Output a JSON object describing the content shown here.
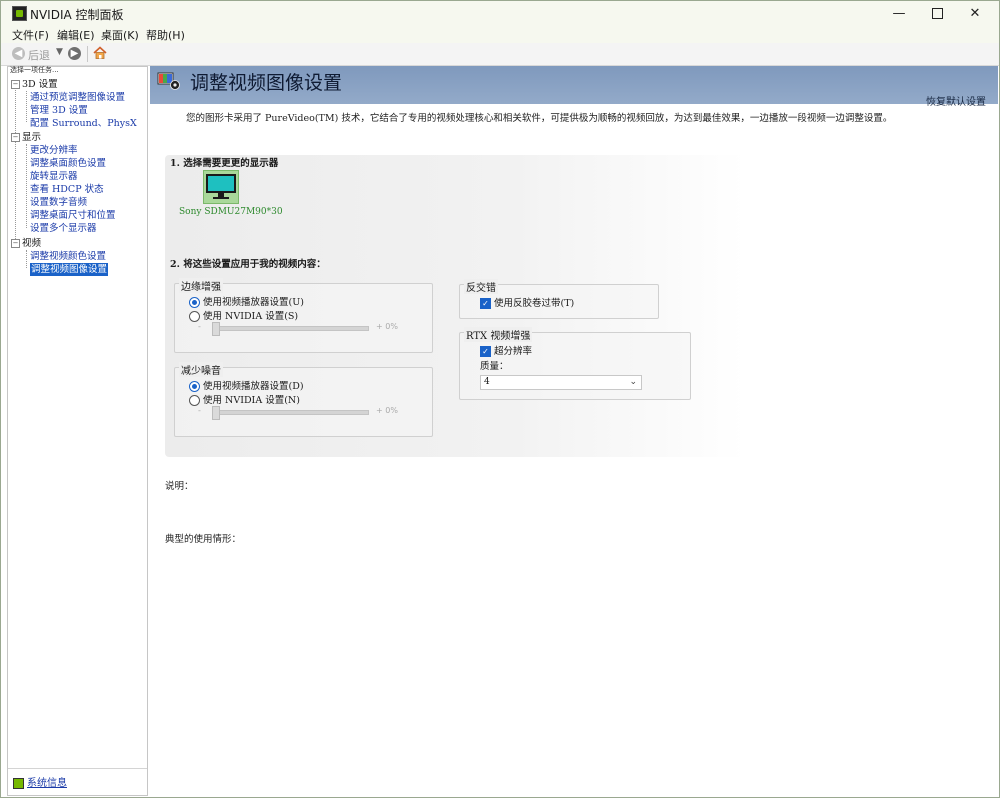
{
  "window": {
    "title": "NVIDIA 控制面板"
  },
  "menu": [
    "文件(F)",
    "编辑(E)",
    "桌面(K)",
    "帮助(H)"
  ],
  "toolbar": {
    "back_label": "后退"
  },
  "left_pane": {
    "task_label": "选择一项任务...",
    "tree": [
      {
        "label": "3D 设置",
        "kind": "parent"
      },
      {
        "label": "通过预览调整图像设置",
        "kind": "child"
      },
      {
        "label": "管理 3D 设置",
        "kind": "child"
      },
      {
        "label": "配置 Surround、PhysX",
        "kind": "child"
      },
      {
        "label": "显示",
        "kind": "parent"
      },
      {
        "label": "更改分辨率",
        "kind": "child"
      },
      {
        "label": "调整桌面颜色设置",
        "kind": "child"
      },
      {
        "label": "旋转显示器",
        "kind": "child"
      },
      {
        "label": "查看 HDCP 状态",
        "kind": "child"
      },
      {
        "label": "设置数字音频",
        "kind": "child"
      },
      {
        "label": "调整桌面尺寸和位置",
        "kind": "child"
      },
      {
        "label": "设置多个显示器",
        "kind": "child"
      },
      {
        "label": "视频",
        "kind": "parent"
      },
      {
        "label": "调整视频颜色设置",
        "kind": "child"
      },
      {
        "label": "调整视频图像设置",
        "kind": "child",
        "selected": true
      }
    ],
    "system_info": "系统信息"
  },
  "main": {
    "title": "调整视频图像设置",
    "restore_defaults": "恢复默认设置",
    "intro": "您的图形卡采用了 PureVideo(TM) 技术，它结合了专用的视频处理核心和相关软件，可提供极为顺畅的视频回放，为达到最佳效果，一边播放一段视频一边调整设置。",
    "section1": {
      "title": "1. 选择需要更更的显示器",
      "monitor_label": "Sony SDMU27M90*30"
    },
    "section2": {
      "title": "2. 将这些设置应用于我的视频内容：",
      "edge": {
        "title": "边缘增强",
        "opt_player": "使用视频播放器设置(U)",
        "opt_nvidia": "使用 NVIDIA 设置(S)",
        "slider_minus": "-",
        "slider_plus": "+ 0%",
        "player_selected": true
      },
      "noise": {
        "title": "减少噪音",
        "opt_player": "使用视频播放器设置(D)",
        "opt_nvidia": "使用 NVIDIA 设置(N)",
        "slider_minus": "-",
        "slider_plus": "+ 0%",
        "player_selected": true
      },
      "deinterlace": {
        "title": "反交错",
        "checkbox": "使用反胶卷过带(T)",
        "checked": true
      },
      "rtx": {
        "title": "RTX 视频增强",
        "checkbox": "超分辨率",
        "checked": true,
        "quality_label": "质量：",
        "quality_value": "4"
      }
    },
    "description_label": "说明：",
    "typical_usage_label": "典型的使用情形："
  },
  "colors": {
    "accent": "#1a62c8",
    "header_band": "#8aa2c4",
    "nvidia_green": "#76b900"
  }
}
